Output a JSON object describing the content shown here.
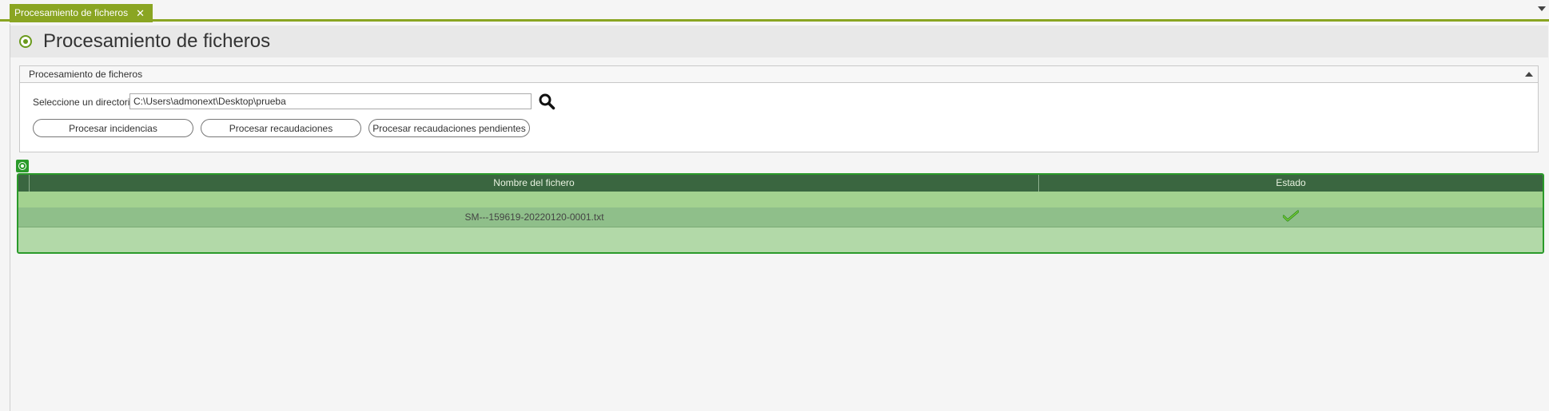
{
  "tab": {
    "label": "Procesamiento de ficheros",
    "close": "✕"
  },
  "page": {
    "title": "Procesamiento de ficheros"
  },
  "panel": {
    "title": "Procesamiento de ficheros",
    "directory_label": "Seleccione un directorio:",
    "directory_value": "C:\\Users\\admonext\\Desktop\\prueba",
    "buttons": {
      "incidencias": "Procesar incidencias",
      "recaudaciones": "Procesar recaudaciones",
      "pendientes": "Procesar recaudaciones pendientes"
    }
  },
  "grid": {
    "columns": {
      "name": "Nombre del fichero",
      "status": "Estado"
    },
    "rows": [
      {
        "name": "SM---159619-20220120-0001.txt",
        "status_icon": "check-icon"
      }
    ]
  },
  "colors": {
    "accent": "#8aa522",
    "grid_border": "#2a9a2a",
    "grid_header": "#3a6640",
    "row_selected": "#8fbf8a",
    "row_alt": "#a3d290"
  }
}
